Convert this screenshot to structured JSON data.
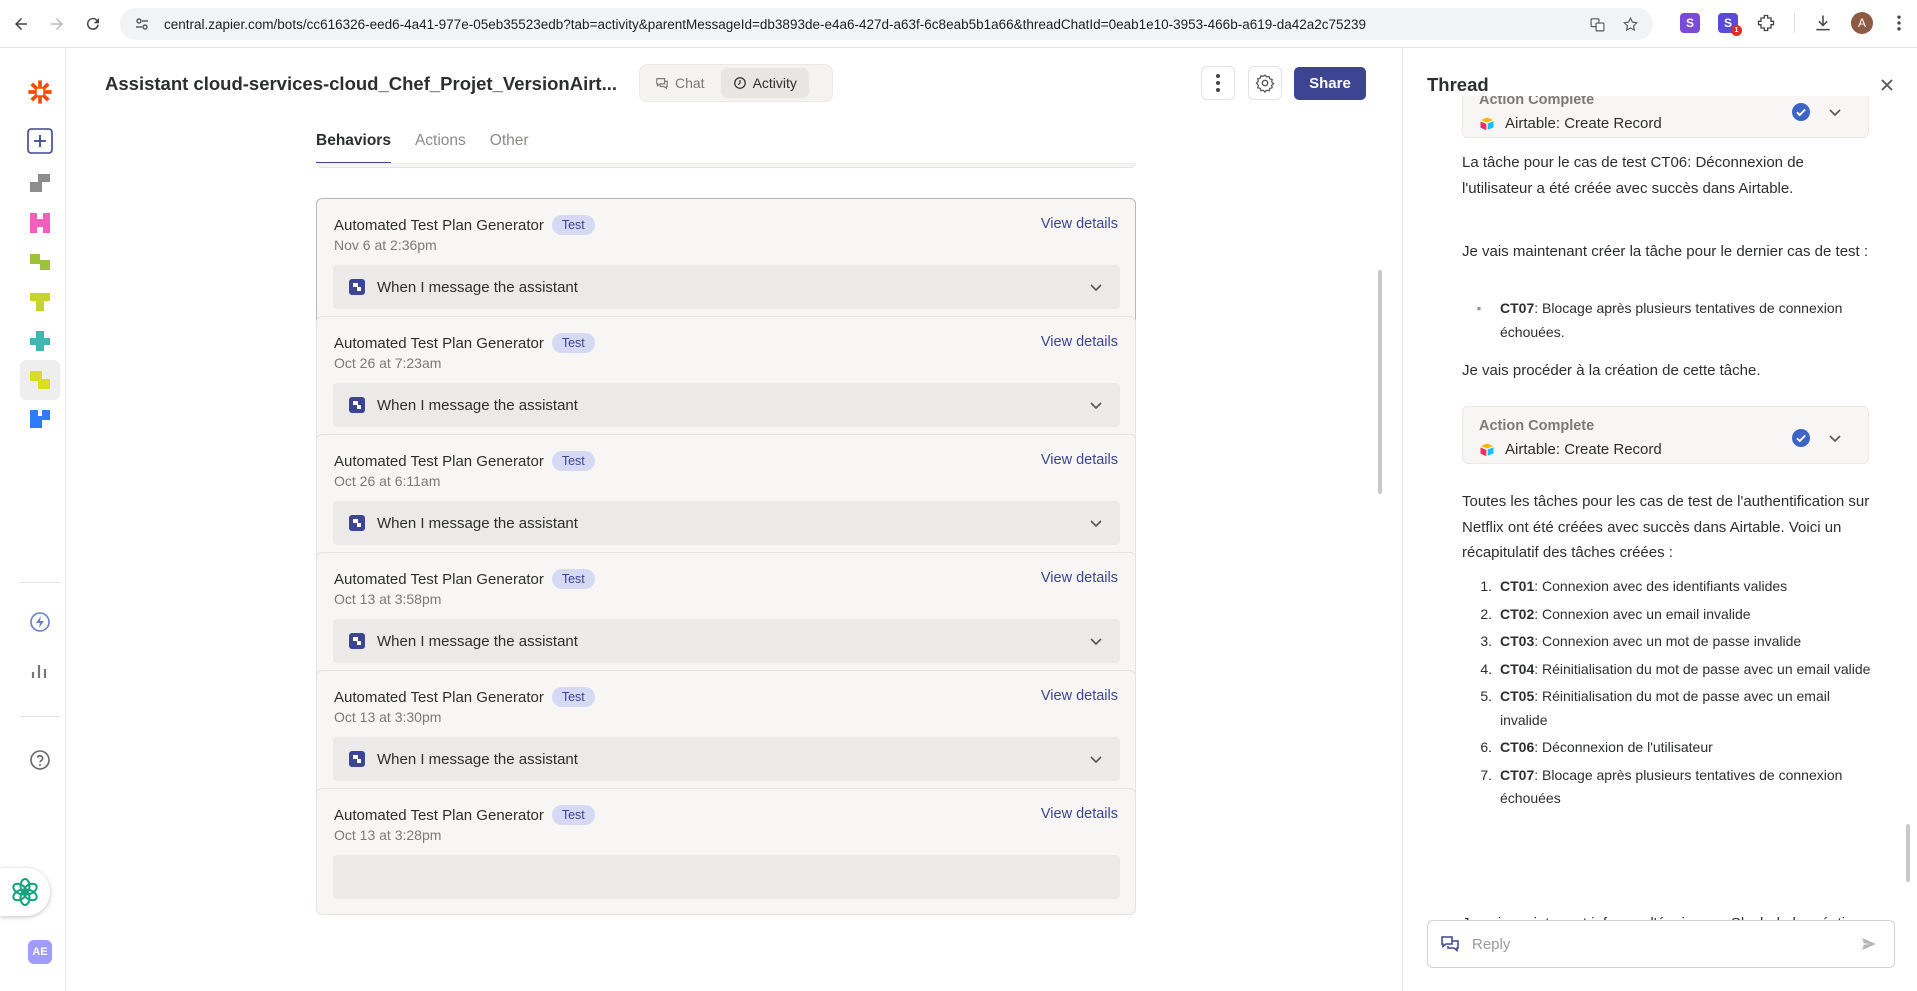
{
  "browser": {
    "url": "central.zapier.com/bots/cc616326-eed6-4a41-977e-05eb35523edb?tab=activity&parentMessageId=db3893de-e4a6-427d-a63f-6c8eab5b1a66&threadChatId=0eab1e10-3953-466b-a619-da42a2c75239",
    "profile_initial": "A",
    "ext_badge": "1"
  },
  "rail": {
    "user_initials": "AE"
  },
  "header": {
    "title": "Assistant cloud-services-cloud_Chef_Projet_VersionAirt...",
    "modes": [
      {
        "label": "Chat"
      },
      {
        "label": "Activity"
      }
    ],
    "share_label": "Share"
  },
  "tabs": [
    {
      "label": "Behaviors"
    },
    {
      "label": "Actions"
    },
    {
      "label": "Other"
    }
  ],
  "feed": {
    "view_details_label": "View details",
    "badge_label": "Test",
    "cards": [
      {
        "title": "Automated Test Plan Generator",
        "time": "Nov 6 at 2:36pm",
        "trigger": "When I message the assistant"
      },
      {
        "title": "Automated Test Plan Generator",
        "time": "Oct 26 at 7:23am",
        "trigger": "When I message the assistant"
      },
      {
        "title": "Automated Test Plan Generator",
        "time": "Oct 26 at 6:11am",
        "trigger": "When I message the assistant"
      },
      {
        "title": "Automated Test Plan Generator",
        "time": "Oct 13 at 3:58pm",
        "trigger": "When I message the assistant"
      },
      {
        "title": "Automated Test Plan Generator",
        "time": "Oct 13 at 3:30pm",
        "trigger": "When I message the assistant"
      },
      {
        "title": "Automated Test Plan Generator",
        "time": "Oct 13 at 3:28pm",
        "trigger": ""
      }
    ]
  },
  "thread": {
    "title": "Thread",
    "action1": {
      "label": "Action Complete",
      "app": "Airtable: Create Record"
    },
    "msg1": "La tâche pour le cas de test CT06: Déconnexion de l'utilisateur a été créée avec succès dans Airtable.",
    "msg2": "Je vais maintenant créer la tâche pour le dernier cas de test :",
    "bullet": {
      "code": "CT07",
      "text": ": Blocage après plusieurs tentatives de connexion échouées."
    },
    "msg3": "Je vais procéder à la création de cette tâche.",
    "action2": {
      "label": "Action Complete",
      "app": "Airtable: Create Record"
    },
    "msg4": "Toutes les tâches pour les cas de test de l'authentification sur Netflix ont été créées avec succès dans Airtable. Voici un récapitulatif des tâches créées :",
    "summary": [
      {
        "num": "1.",
        "code": "CT01",
        "text": ": Connexion avec des identifiants valides"
      },
      {
        "num": "2.",
        "code": "CT02",
        "text": ": Connexion avec un email invalide"
      },
      {
        "num": "3.",
        "code": "CT03",
        "text": ": Connexion avec un mot de passe invalide"
      },
      {
        "num": "4.",
        "code": "CT04",
        "text": ": Réinitialisation du mot de passe avec un email valide"
      },
      {
        "num": "5.",
        "code": "CT05",
        "text": ": Réinitialisation du mot de passe avec un email invalide"
      },
      {
        "num": "6.",
        "code": "CT06",
        "text": ": Déconnexion de l'utilisateur"
      },
      {
        "num": "7.",
        "code": "CT07",
        "text": ": Blocage après plusieurs tentatives de connexion échouées"
      }
    ],
    "msg5": "Je vais maintenant informer l'équipe sur Slack de la création du plan de test et des allocations de ressources.",
    "reply_placeholder": "Reply"
  },
  "colors": {
    "brand_orange": "#ff4a00",
    "primary": "#3d4592",
    "badge_bg": "#d6d9f4"
  }
}
